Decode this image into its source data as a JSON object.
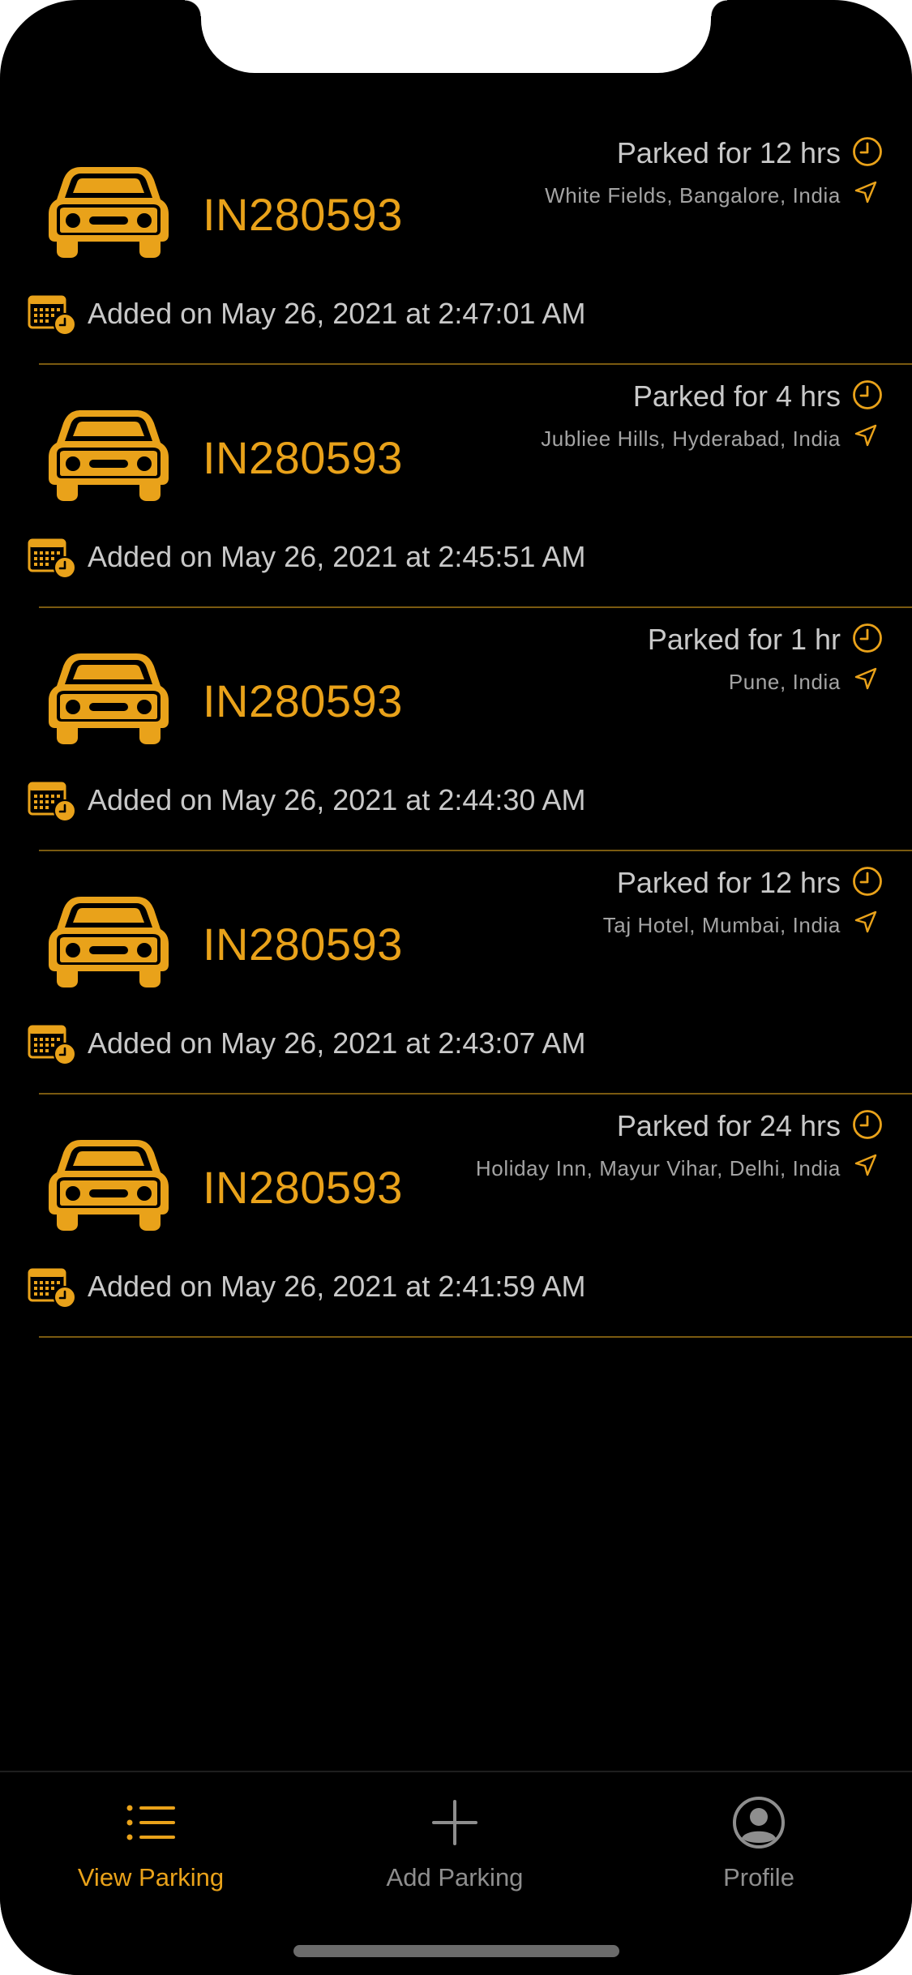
{
  "colors": {
    "accent": "#E9A21A",
    "background": "#000000",
    "text_primary": "#c9c9c9",
    "text_secondary": "#a4a4a4",
    "tab_inactive": "#8e8e8e",
    "divider": "#7a5a10"
  },
  "parking_list": [
    {
      "plate": "IN280593",
      "duration": "Parked for 12 hrs",
      "location": "White Fields, Bangalore, India",
      "added": "Added on May 26, 2021 at 2:47:01 AM"
    },
    {
      "plate": "IN280593",
      "duration": "Parked for 4 hrs",
      "location": "Jubliee Hills, Hyderabad, India",
      "added": "Added on May 26, 2021 at 2:45:51 AM"
    },
    {
      "plate": "IN280593",
      "duration": "Parked for 1 hr",
      "location": "Pune, India",
      "added": "Added on May 26, 2021 at 2:44:30 AM"
    },
    {
      "plate": "IN280593",
      "duration": "Parked for 12 hrs",
      "location": "Taj Hotel, Mumbai, India",
      "added": "Added on May 26, 2021 at 2:43:07 AM"
    },
    {
      "plate": "IN280593",
      "duration": "Parked for 24 hrs",
      "location": "Holiday Inn, Mayur Vihar, Delhi, India",
      "added": "Added on May 26, 2021 at 2:41:59 AM"
    }
  ],
  "tabbar": {
    "items": [
      {
        "label": "View Parking",
        "icon": "list-icon",
        "active": true
      },
      {
        "label": "Add Parking",
        "icon": "plus-icon",
        "active": false
      },
      {
        "label": "Profile",
        "icon": "person-circle-icon",
        "active": false
      }
    ]
  }
}
